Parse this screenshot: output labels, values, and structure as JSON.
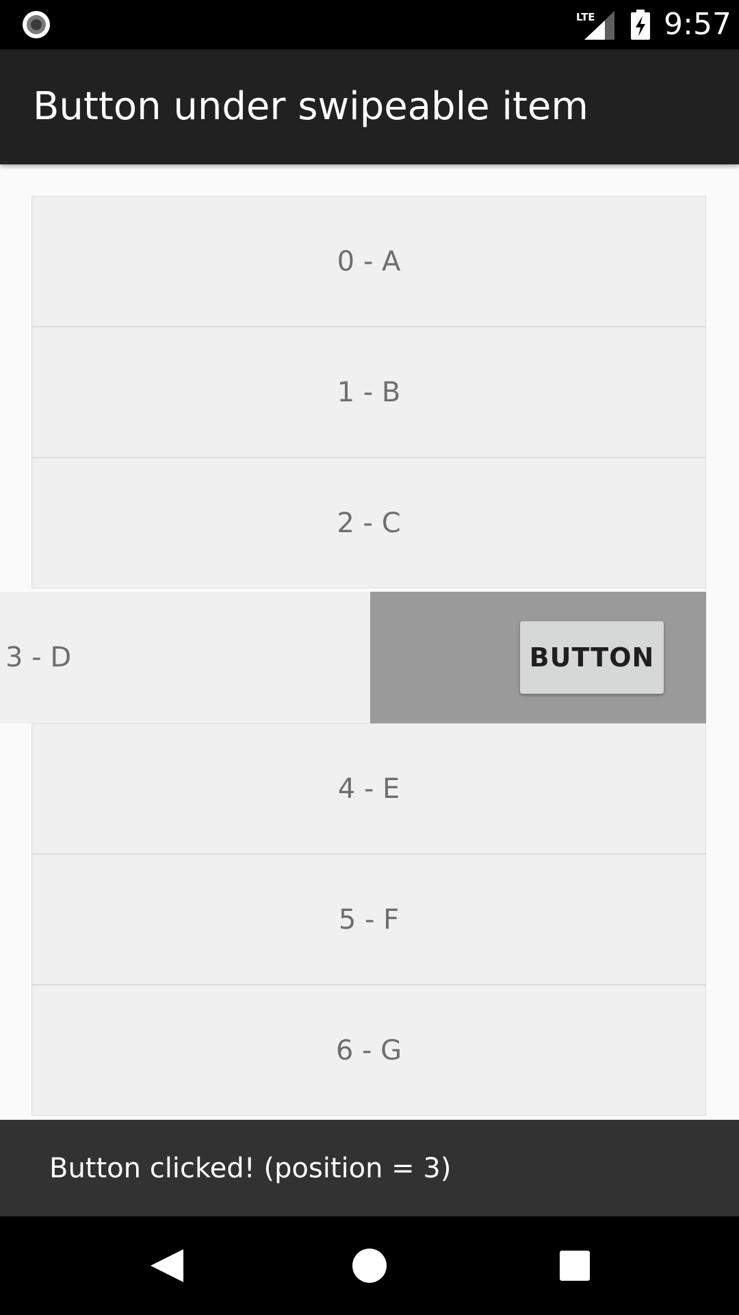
{
  "status_bar": {
    "time": "9:57",
    "icons": [
      "record-indicator-icon",
      "lte-signal-icon",
      "battery-charging-icon"
    ]
  },
  "app_bar": {
    "title": "Button under swipeable item"
  },
  "list": {
    "items": [
      {
        "label": "0 - A"
      },
      {
        "label": "1 - B"
      },
      {
        "label": "2 - C"
      },
      {
        "label": "3 - D",
        "swiped": true,
        "under_button": "BUTTON"
      },
      {
        "label": "4 - E"
      },
      {
        "label": "5 - F"
      },
      {
        "label": "6 - G"
      }
    ]
  },
  "snackbar": {
    "message": "Button clicked! (position = 3)"
  },
  "nav_bar": {
    "icons": [
      "back-icon",
      "home-icon",
      "recents-icon"
    ]
  },
  "colors": {
    "status_bar": "#000000",
    "app_bar": "#212121",
    "list_background": "#fafafa",
    "row_background": "#f0f0f0",
    "swipe_background": "#9a9a9a",
    "button_background": "#d6d7d7",
    "snackbar": "#323232",
    "nav_bar": "#000000"
  }
}
